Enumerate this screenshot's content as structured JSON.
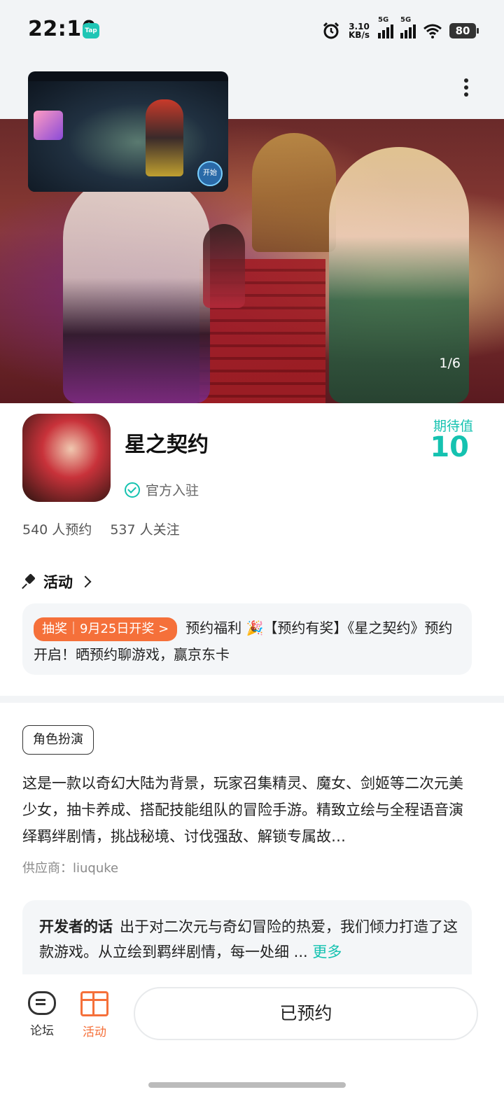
{
  "status_bar": {
    "time": "22:10",
    "app_badge": "Tap",
    "net_speed_value": "3.10",
    "net_speed_unit": "KB/s",
    "sim1": "5G",
    "sim2": "5G",
    "battery": "80",
    "icons": [
      "alarm-icon",
      "signal-icon",
      "wifi-icon",
      "battery-icon"
    ]
  },
  "app_bar": {
    "menu_icon": "more-vertical-icon"
  },
  "banner": {
    "page_indicator": "1/6",
    "current_page": 1,
    "total_pages": 6
  },
  "pip": {
    "start_label": "开始"
  },
  "game": {
    "title": "星之契约",
    "verified_label": "官方入驻",
    "expectation_label": "期待值",
    "expectation_value": "10",
    "reservations": "540 人预约",
    "followers": "537 人关注"
  },
  "activity": {
    "header": "活动",
    "tag": "抽奖｜9月25日开奖 >",
    "text": "预约福利 🎉【预约有奖】《星之契约》预约开启！晒预约聊游戏，赢京东卡"
  },
  "details": {
    "genre_tag": "角色扮演",
    "description": "这是一款以奇幻大陆为背景，玩家召集精灵、魔女、剑姬等二次元美少女，抽卡养成、搭配技能组队的冒险手游。精致立绘与全程语音演绎羁绊剧情，挑战秘境、讨伐强敌、解锁专属故…",
    "supplier": "供应商：liuquke"
  },
  "developer_note": {
    "title": "开发者的话",
    "text": "出于对二次元与奇幻冒险的热爱，我们倾力打造了这款游戏。从立绘到羁绊剧情，每一处细 ...",
    "more_label": "更多"
  },
  "bottom_nav": {
    "forum_label": "论坛",
    "activity_label": "活动",
    "reserved_label": "已预约"
  },
  "colors": {
    "accent": "#15c2b0",
    "orange": "#f5703a"
  }
}
